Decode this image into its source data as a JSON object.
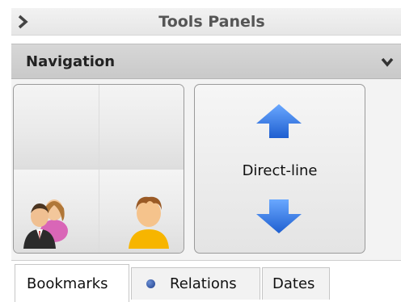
{
  "header": {
    "title": "Tools Panels",
    "toggle_icon": "chevron-right-icon"
  },
  "navigation": {
    "title": "Navigation",
    "collapse_icon": "chevron-down-icon"
  },
  "nav_grid": {
    "cells": [
      {
        "name": "empty-slot-1"
      },
      {
        "name": "empty-slot-2"
      },
      {
        "name": "group-users-icon"
      },
      {
        "name": "single-user-icon"
      }
    ]
  },
  "direct_line": {
    "label": "Direct-line",
    "up_icon": "arrow-up-icon",
    "down_icon": "arrow-down-icon",
    "arrow_color": "#2b6fdc"
  },
  "tabs": [
    {
      "label": "Bookmarks",
      "active": true
    },
    {
      "label": "Relations",
      "active": false,
      "icon": "dot-icon"
    },
    {
      "label": "Dates",
      "active": false
    }
  ]
}
